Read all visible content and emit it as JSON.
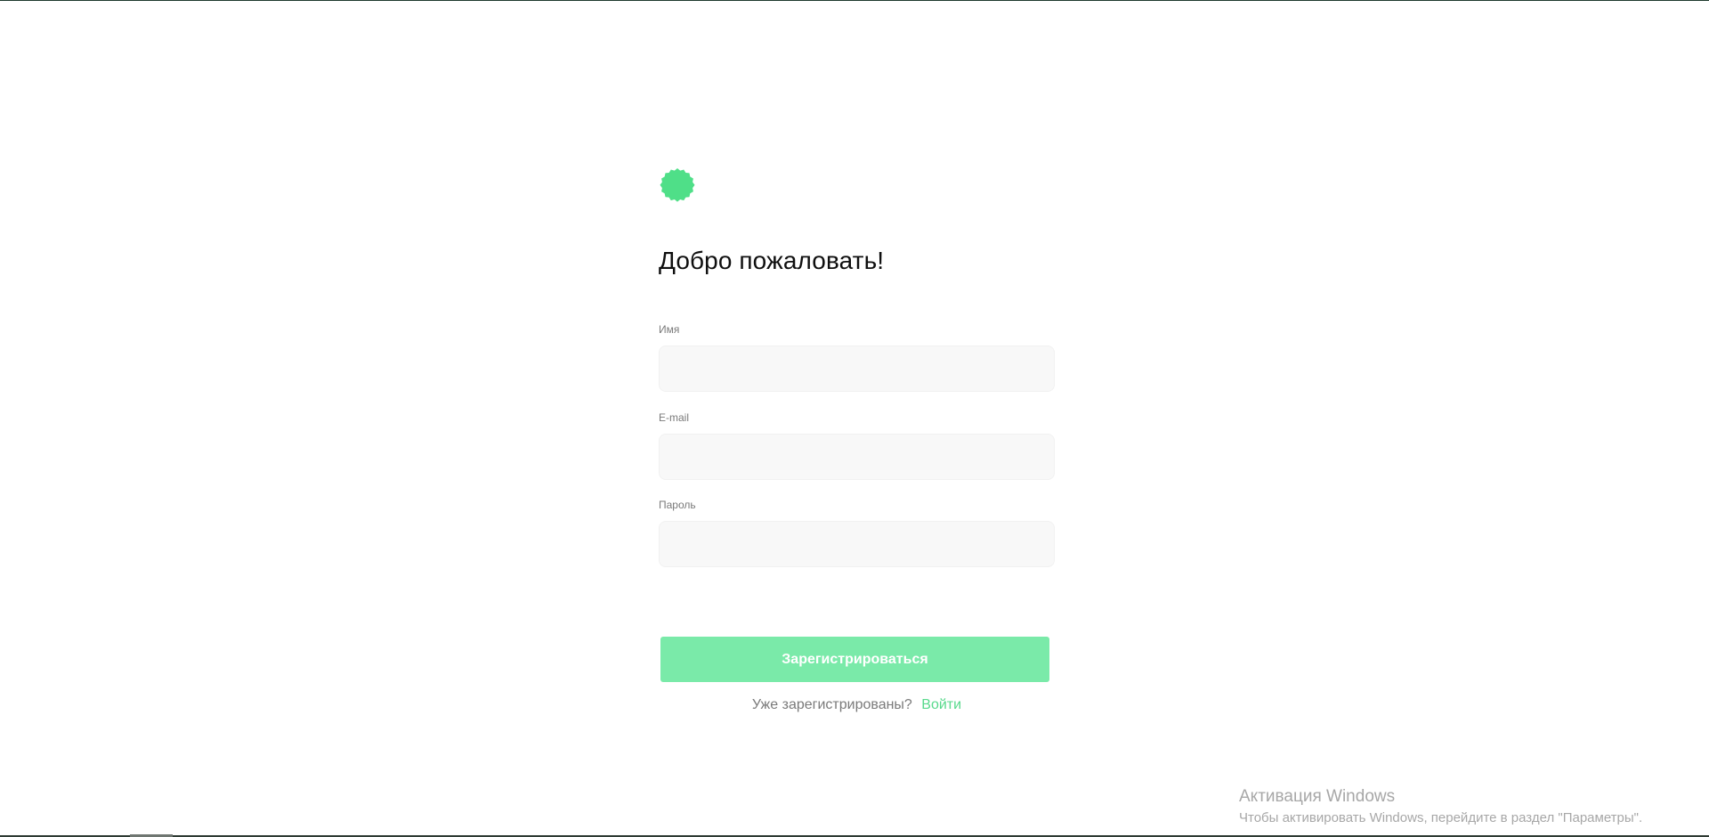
{
  "title": "Добро пожаловать!",
  "form": {
    "name_label": "Имя",
    "name_value": "",
    "email_label": "E-mail",
    "email_value": "",
    "password_label": "Пароль",
    "password_value": ""
  },
  "actions": {
    "register_button": "Зарегистрироваться"
  },
  "signin": {
    "prompt": "Уже зарегистрированы?",
    "link": "Войти"
  },
  "windows_notice": {
    "title": "Активация Windows",
    "subtitle": "Чтобы активировать Windows, перейдите в раздел \"Параметры\"."
  },
  "colors": {
    "accent": "#58d98c",
    "button_background": "#7aeaa9",
    "input_background": "#f8f8f8",
    "muted_text": "#7a7a7a",
    "windows_text": "#a7a7a7"
  },
  "icons": {
    "logo": "green-badge-icon"
  }
}
